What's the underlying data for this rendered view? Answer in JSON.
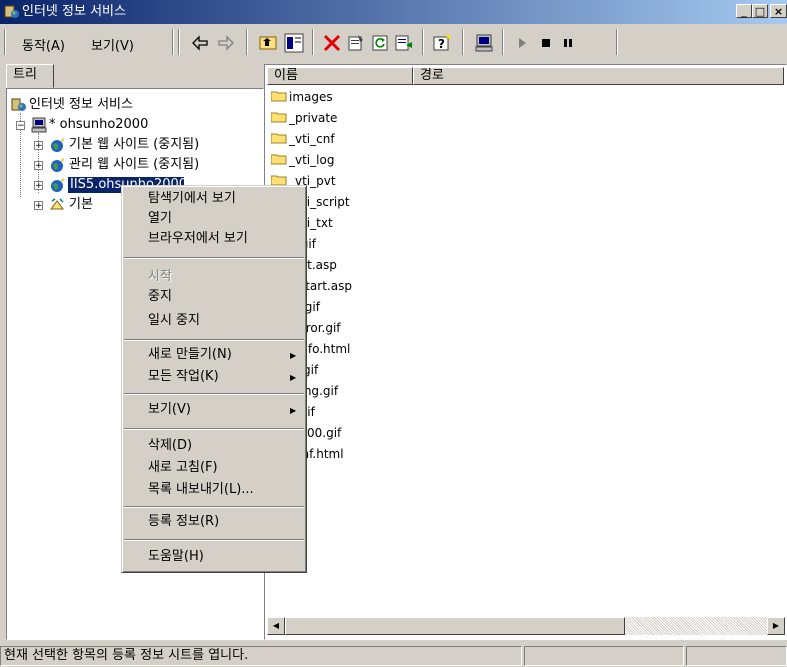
{
  "window": {
    "title": "인터넷 정보 서비스"
  },
  "menu": {
    "action": "동작(A)",
    "view": "보기(V)"
  },
  "left_pane": {
    "tab": "트리"
  },
  "tree": [
    {
      "label": "인터넷 정보 서비스"
    },
    {
      "label": "* ohsunho2000"
    },
    {
      "label": "기본 웹 사이트 (중지됨)"
    },
    {
      "label": "관리 웹 사이트 (중지됨)"
    },
    {
      "label": "IIS5.ohsunho2000"
    },
    {
      "label": "기본"
    }
  ],
  "columns": {
    "name": "이름",
    "path": "경로"
  },
  "files": [
    "images",
    "_private",
    "_vti_cnf",
    "_vti_log",
    "_vti_pvt",
    "_vti_script",
    "_vti_txt",
    "help.gif",
    "iisstart.asp",
    "localstart.asp",
    "mmc.gif",
    "pagerror.gif",
    "postinfo.html",
    "print.gif",
    "warning.gif",
    "web.gif",
    "win2000.gif",
    "_vti_inf.html"
  ],
  "context_menu": {
    "explore": "탐색기에서 보기",
    "open": "열기",
    "browse": "브라우저에서 보기",
    "start": "시작",
    "stop": "중지",
    "pause": "일시 중지",
    "new": "새로 만들기(N)",
    "all_tasks": "모든 작업(K)",
    "view": "보기(V)",
    "delete": "삭제(D)",
    "refresh": "새로 고침(F)",
    "export": "목록 내보내기(L)...",
    "properties": "등록 정보(R)",
    "help": "도움말(H)"
  },
  "status": {
    "text": "현재 선택한 항목의 등록 정보 시트를 엽니다."
  },
  "colors": {
    "title_start": "#0a246a",
    "title_end": "#a6caf0",
    "selection": "#0a246a",
    "chrome": "#d4d0c8"
  }
}
